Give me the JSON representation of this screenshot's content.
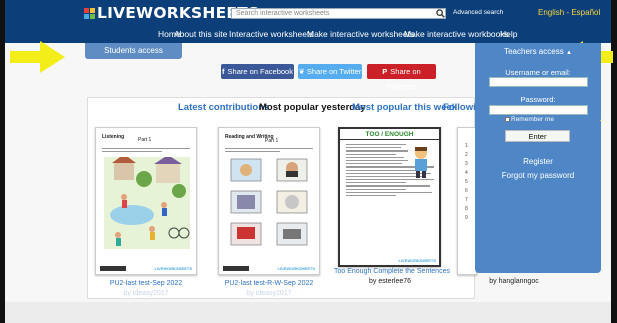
{
  "brand": {
    "logo_text": "LIVEWORKSHEETS",
    "square_colors": [
      "#e8433a",
      "#f3c33a",
      "#48a8e0",
      "#6cc04a"
    ]
  },
  "search": {
    "placeholder": "Search interactive worksheets",
    "advanced_label": "Advanced search"
  },
  "language": {
    "label": "English - Español"
  },
  "nav": {
    "items": [
      "Home",
      "About this site",
      "Interactive worksheets",
      "Make interactive worksheets",
      "Make interactive workbooks",
      "Help"
    ]
  },
  "students": {
    "label": "Students access"
  },
  "share": {
    "facebook": "Share on Facebook",
    "twitter": "Share on Twitter",
    "pinterest": "Share on Pinterest",
    "facebook_glyph": "f",
    "twitter_glyph": "❦",
    "pinterest_glyph": "P"
  },
  "tabs": [
    "Latest contributions",
    "Most popular yesterday",
    "Most popular this week",
    "Followin"
  ],
  "worksheets": [
    {
      "title": "PU2-last test-Sep 2022",
      "author": "by ideasy2017",
      "thumb_heading": "Listening",
      "thumb_part": "Part 1"
    },
    {
      "title": "PU2-last test-R-W-Sep 2022",
      "author": "by ideasy2017",
      "thumb_heading": "Reading and Writing",
      "thumb_part": "Part 1"
    },
    {
      "title": "Too Enough Complete the Sentences",
      "author": "by esterlee76",
      "thumb_heading": "TOO / ENOUGH"
    },
    {
      "title": "",
      "author": "by hanglanngoc"
    }
  ],
  "teachers": {
    "title": "Teachers access",
    "title_arrow": "▲",
    "username_label": "Username or email:",
    "password_label": "Password:",
    "remember_label": "Remember me",
    "enter_label": "Enter",
    "register_label": "Register",
    "forgot_label": "Forgot my password"
  },
  "colors": {
    "topbar": "#0c3f7a",
    "accent_blue": "#4f86c6",
    "tab_link": "#2f72c3",
    "arrow_yellow": "#f3ee1a",
    "facebook": "#3b5998",
    "twitter": "#55acee",
    "pinterest": "#cb2027"
  }
}
